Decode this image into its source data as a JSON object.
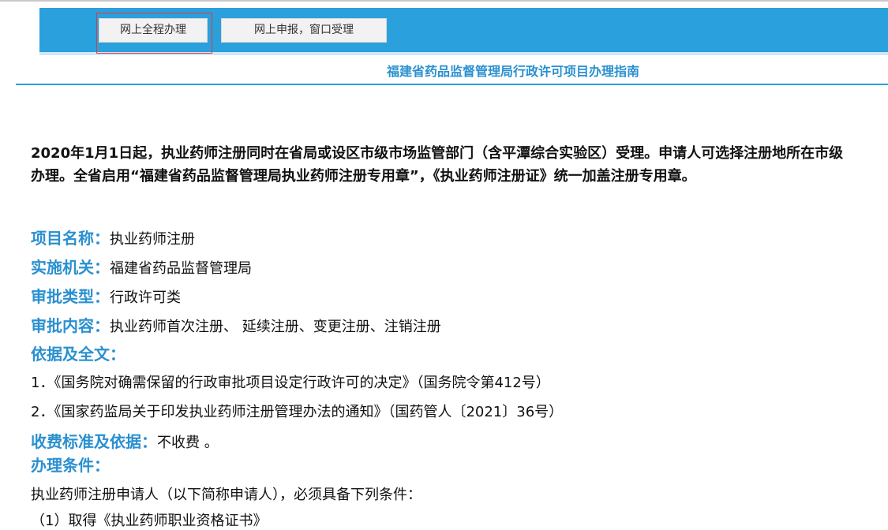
{
  "tabs": [
    {
      "label": "网上全程办理"
    },
    {
      "label": "网上申报，窗口受理"
    }
  ],
  "page_title": "福建省药品监督管理局行政许可项目办理指南",
  "notice": {
    "line1": "2020年1月1日起，执业药师注册同时在省局或设区市级市场监管部门（含平潭综合实验区）受理。申请人可选择注册地所在市级",
    "line2": "办理。全省启用“福建省药品监督管理局执业药师注册专用章”，《执业药师注册证》统一加盖注册专用章。"
  },
  "fields": {
    "project_name": {
      "label": "项目名称：",
      "value": "执业药师注册"
    },
    "authority": {
      "label": "实施机关：",
      "value": "福建省药品监督管理局"
    },
    "approval_type": {
      "label": "审批类型：",
      "value": "行政许可类"
    },
    "approval_content": {
      "label": "审批内容：",
      "value": "执业药师首次注册、 延续注册、变更注册、注销注册"
    },
    "basis": {
      "label": "依据及全文：",
      "value": ""
    },
    "fee": {
      "label": "收费标准及依据：",
      "value": "不收费 。"
    },
    "conditions": {
      "label": "办理条件：",
      "value": ""
    }
  },
  "basis_items": [
    "1．《国务院对确需保留的行政审批项目设定行政许可的决定》（国务院令第412号）",
    "2．《国家药监局关于印发执业药师注册管理办法的通知》（国药管人〔2021〕36号）"
  ],
  "conditions_intro": "执业药师注册申请人（以下简称申请人），必须具备下列条件：",
  "conditions_first": "（1）取得《执业药师职业资格证书》"
}
